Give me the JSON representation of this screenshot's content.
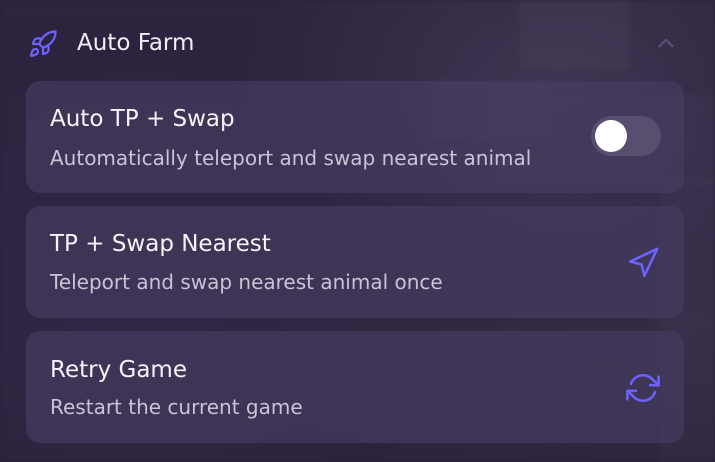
{
  "colors": {
    "accent": "#6c63ff",
    "panel": "#28203e",
    "card": "#483e62",
    "text_primary": "#f6f4fa",
    "text_secondary": "#c9c3d6",
    "toggle_track": "#5f5676",
    "toggle_knob": "#ffffff"
  },
  "section": {
    "title": "Auto Farm",
    "icon": "rocket-icon",
    "collapse_icon": "chevron-up-icon"
  },
  "items": [
    {
      "title": "Auto TP + Swap",
      "description": "Automatically teleport and swap nearest animal",
      "control": "toggle",
      "toggle_on": false
    },
    {
      "title": "TP + Swap Nearest",
      "description": "Teleport and swap nearest animal once",
      "control": "button",
      "icon": "send-icon"
    },
    {
      "title": "Retry Game",
      "description": "Restart the current game",
      "control": "button",
      "icon": "refresh-icon"
    }
  ]
}
